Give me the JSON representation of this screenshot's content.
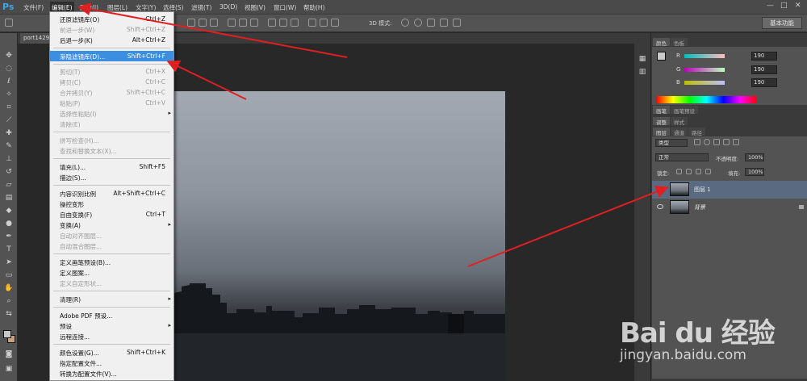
{
  "app": {
    "logo": "Ps",
    "menu": [
      "文件(F)",
      "编辑(E)",
      "图像(I)",
      "图层(L)",
      "文字(Y)",
      "选择(S)",
      "滤镜(T)",
      "3D(D)",
      "视图(V)",
      "窗口(W)",
      "帮助(H)"
    ],
    "window_controls": [
      "—",
      "□",
      "✕"
    ]
  },
  "optionsbar": {
    "mode3d": "3D 模式:",
    "workspace": "基本功能"
  },
  "document": {
    "tab": "port1429"
  },
  "edit_menu": {
    "items": [
      {
        "label": "还原滤镜库(O)",
        "shortcut": "Ctrl+Z",
        "disabled": false
      },
      {
        "label": "前进一步(W)",
        "shortcut": "Shift+Ctrl+Z",
        "disabled": true
      },
      {
        "label": "后退一步(K)",
        "shortcut": "Alt+Ctrl+Z",
        "disabled": false
      },
      {
        "label": "渐隐滤镜库(D)...",
        "shortcut": "Shift+Ctrl+F",
        "disabled": false,
        "highlight": true
      },
      {
        "label": "剪切(T)",
        "shortcut": "Ctrl+X",
        "disabled": true
      },
      {
        "label": "拷贝(C)",
        "shortcut": "Ctrl+C",
        "disabled": true
      },
      {
        "label": "合并拷贝(Y)",
        "shortcut": "Shift+Ctrl+C",
        "disabled": true
      },
      {
        "label": "粘贴(P)",
        "shortcut": "Ctrl+V",
        "disabled": true
      },
      {
        "label": "选择性粘贴(I)",
        "shortcut": "",
        "disabled": true,
        "submenu": true
      },
      {
        "label": "清除(E)",
        "shortcut": "",
        "disabled": true
      },
      {
        "label": "拼写检查(H)...",
        "shortcut": "",
        "disabled": true
      },
      {
        "label": "查找和替换文本(X)...",
        "shortcut": "",
        "disabled": true
      },
      {
        "label": "填充(L)...",
        "shortcut": "Shift+F5",
        "disabled": false
      },
      {
        "label": "描边(S)...",
        "shortcut": "",
        "disabled": false
      },
      {
        "label": "内容识别比例",
        "shortcut": "Alt+Shift+Ctrl+C",
        "disabled": false
      },
      {
        "label": "操控变形",
        "shortcut": "",
        "disabled": false
      },
      {
        "label": "自由变换(F)",
        "shortcut": "Ctrl+T",
        "disabled": false
      },
      {
        "label": "变换(A)",
        "shortcut": "",
        "disabled": false,
        "submenu": true
      },
      {
        "label": "自动对齐图层...",
        "shortcut": "",
        "disabled": true
      },
      {
        "label": "自动混合图层...",
        "shortcut": "",
        "disabled": true
      },
      {
        "label": "定义画笔预设(B)...",
        "shortcut": "",
        "disabled": false
      },
      {
        "label": "定义图案...",
        "shortcut": "",
        "disabled": false
      },
      {
        "label": "定义自定形状...",
        "shortcut": "",
        "disabled": true
      },
      {
        "label": "清理(R)",
        "shortcut": "",
        "disabled": false,
        "submenu": true
      },
      {
        "label": "Adobe PDF 预设...",
        "shortcut": "",
        "disabled": false
      },
      {
        "label": "预设",
        "shortcut": "",
        "disabled": false,
        "submenu": true
      },
      {
        "label": "远程连接...",
        "shortcut": "",
        "disabled": false
      },
      {
        "label": "颜色设置(G)...",
        "shortcut": "Shift+Ctrl+K",
        "disabled": false
      },
      {
        "label": "指定配置文件...",
        "shortcut": "",
        "disabled": false
      },
      {
        "label": "转换为配置文件(V)...",
        "shortcut": "",
        "disabled": false
      }
    ]
  },
  "color_panel": {
    "tabs": [
      "颜色",
      "色板"
    ],
    "r_label": "R",
    "g_label": "G",
    "b_label": "B",
    "r_value": "190",
    "g_value": "190",
    "b_value": "190"
  },
  "panels": {
    "brush_tabs": [
      "画笔",
      "画笔预设"
    ],
    "adjust_tabs": [
      "调整",
      "样式"
    ],
    "layer_tabs": [
      "图层",
      "通道",
      "路径"
    ]
  },
  "layers_panel": {
    "filter": "类型",
    "blend_mode": "正常",
    "opacity_label": "不透明度:",
    "opacity": "100%",
    "lock_label": "锁定:",
    "fill_label": "填充:",
    "fill": "100%",
    "layers": [
      {
        "name": "图层 1",
        "selected": true,
        "locked": false
      },
      {
        "name": "背景",
        "selected": false,
        "locked": true
      }
    ]
  },
  "watermark": {
    "logo": "Bai du 经验",
    "url": "jingyan.baidu.com"
  },
  "colors": {
    "highlight": "#3c8ee0",
    "arrow": "#e02020",
    "fg": "#c8c8c8",
    "bg": "#c9a27b"
  }
}
